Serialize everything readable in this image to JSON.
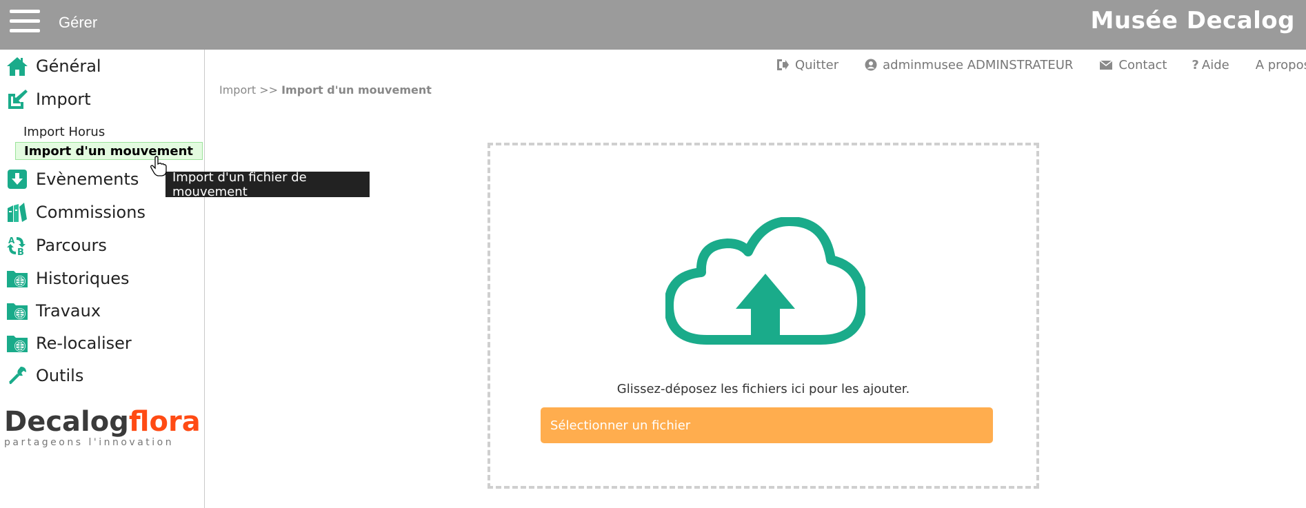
{
  "topbar": {
    "menu_label": "Gérer",
    "app_title": "Musée Decalog"
  },
  "sidebar": {
    "items": [
      {
        "label": "Général",
        "icon": "home-icon"
      },
      {
        "label": "Import",
        "icon": "import-icon"
      },
      {
        "label": "Evènements",
        "icon": "download-box-icon"
      },
      {
        "label": "Commissions",
        "icon": "books-icon"
      },
      {
        "label": "Parcours",
        "icon": "ab-arrows-icon"
      },
      {
        "label": "Historiques",
        "icon": "folder-globe-icon"
      },
      {
        "label": "Travaux",
        "icon": "folder-globe-icon"
      },
      {
        "label": "Re-localiser",
        "icon": "folder-globe-icon"
      },
      {
        "label": "Outils",
        "icon": "wrench-icon"
      }
    ],
    "import_submenu": [
      {
        "label": "Import Horus",
        "active": false
      },
      {
        "label": "Import d'un mouvement",
        "active": true
      }
    ],
    "tooltip": "Import d'un fichier de mouvement"
  },
  "logo": {
    "brand_a": "Decalog",
    "brand_b": "flora",
    "tagline": "partageons l'innovation"
  },
  "toplinks": {
    "quit": "Quitter",
    "user": "adminmusee ADMINSTRATEUR",
    "contact": "Contact",
    "help": "Aide",
    "about": "A propos"
  },
  "breadcrumb": {
    "parent": "Import >>",
    "current": "Import d'un mouvement"
  },
  "dropzone": {
    "hint": "Glissez-déposez les fichiers ici pour les ajouter.",
    "select_button": "Sélectionner un fichier"
  },
  "colors": {
    "topbar": "#9b9b9b",
    "accent_green": "#1aab8a",
    "button_orange": "#ffad4e",
    "logo_orange": "#ff4b14"
  }
}
